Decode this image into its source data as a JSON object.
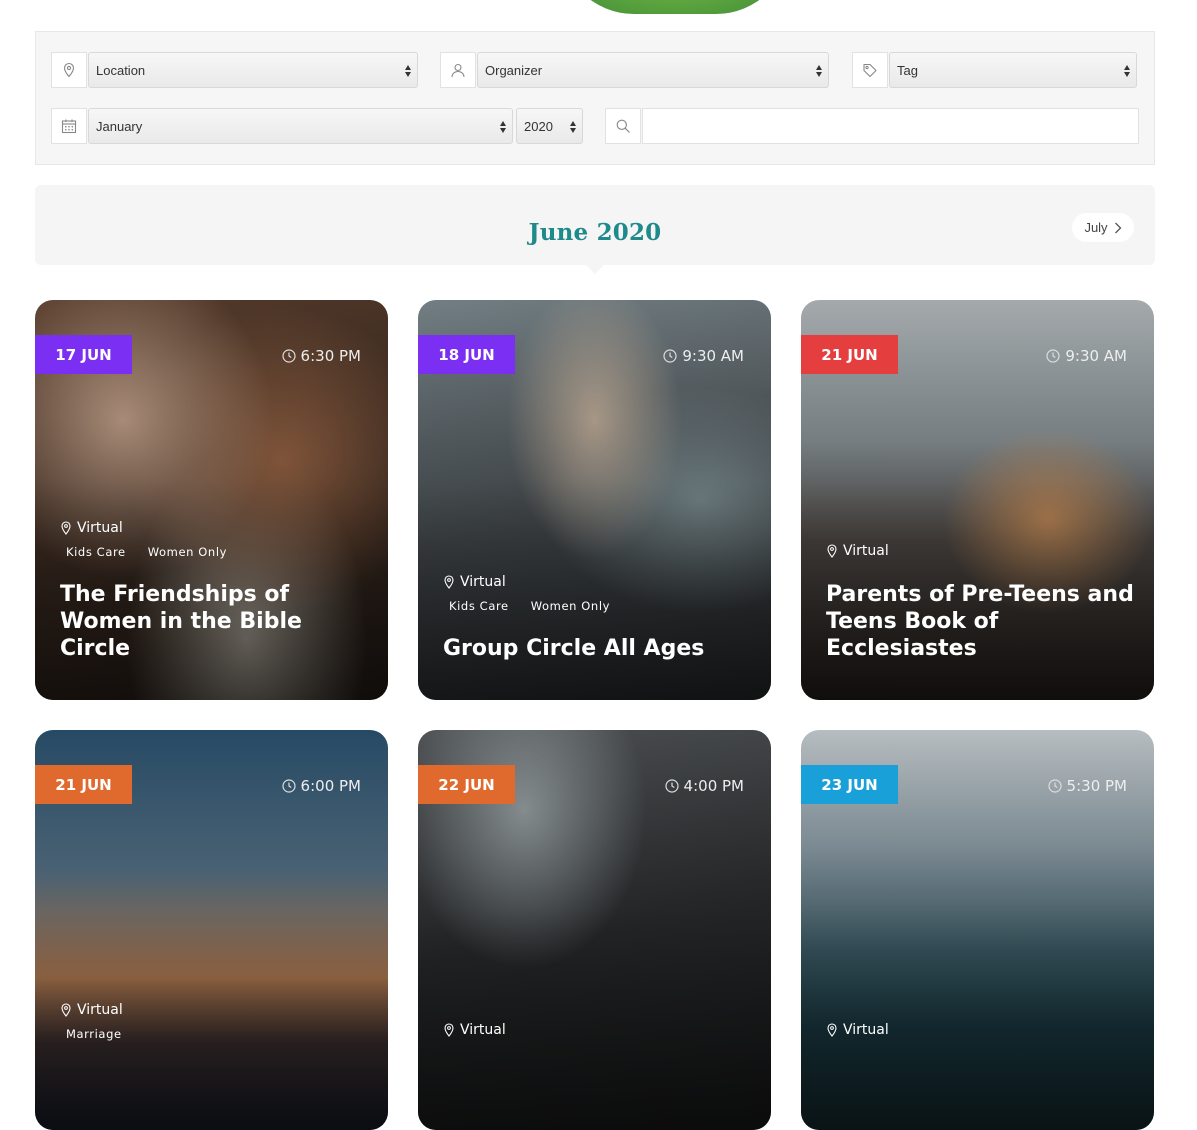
{
  "filters": {
    "location": "Location",
    "organizer": "Organizer",
    "tag": "Tag",
    "month": "January",
    "year": "2020",
    "search_value": ""
  },
  "calendar": {
    "current_month": "June 2020",
    "next_month": "July"
  },
  "events": [
    {
      "date": "17 JUN",
      "time": "6:30 PM",
      "location": "Virtual",
      "tags": [
        "Kids Care",
        "Women Only"
      ],
      "title": "The Friendships of Women in the Bible Circle",
      "badge_color": "#7b2ff2"
    },
    {
      "date": "18 JUN",
      "time": "9:30 AM",
      "location": "Virtual",
      "tags": [
        "Kids Care",
        "Women Only"
      ],
      "title": "Group Circle All Ages",
      "badge_color": "#7b2ff2"
    },
    {
      "date": "21 JUN",
      "time": "9:30 AM",
      "location": "Virtual",
      "tags": [],
      "title": "Parents of Pre-Teens and Teens Book of Ecclesiastes",
      "badge_color": "#e53e3e"
    },
    {
      "date": "21 JUN",
      "time": "6:00 PM",
      "location": "Virtual",
      "tags": [
        "Marriage"
      ],
      "title": "",
      "badge_color": "#e06a2e"
    },
    {
      "date": "22 JUN",
      "time": "4:00 PM",
      "location": "Virtual",
      "tags": [],
      "title": "",
      "badge_color": "#e06a2e"
    },
    {
      "date": "23 JUN",
      "time": "5:30 PM",
      "location": "Virtual",
      "tags": [],
      "title": "",
      "badge_color": "#1aa0d8"
    }
  ],
  "colors": {
    "accent": "#1f8a8a",
    "filter_bg": "#f6f6f6"
  }
}
